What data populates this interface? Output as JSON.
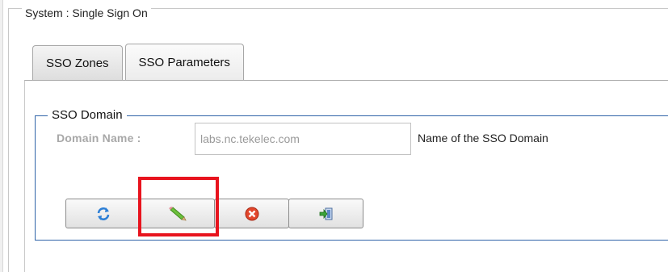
{
  "group": {
    "title": "System : Single Sign On"
  },
  "tabs": [
    {
      "label": "SSO Zones",
      "active": false
    },
    {
      "label": "SSO Parameters",
      "active": true
    }
  ],
  "sso_domain": {
    "legend": "SSO Domain",
    "domain_name_label": "Domain Name :",
    "domain_name_value": "labs.nc.tekelec.com",
    "domain_name_hint": "Name of the SSO Domain"
  },
  "toolbar": {
    "buttons": [
      {
        "icon": "refresh-icon"
      },
      {
        "icon": "pencil-icon"
      },
      {
        "icon": "cancel-icon"
      },
      {
        "icon": "export-icon"
      }
    ]
  },
  "colors": {
    "group_border": "#2f63a8",
    "highlight": "#e8141e",
    "disabled_label": "#a8a8a8"
  }
}
